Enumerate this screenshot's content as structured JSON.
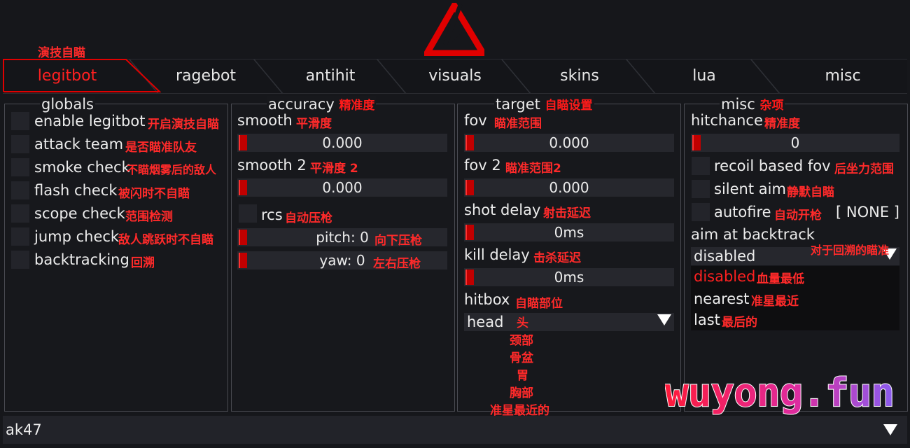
{
  "colors": {
    "accent": "#ff1a1a",
    "background": "#16171b",
    "panel": "#17181c",
    "control": "#26272d"
  },
  "header": {
    "logo_icon": "red-triangle-logo-icon",
    "annotation": "演技自瞄"
  },
  "tabs": [
    "legitbot",
    "ragebot",
    "antihit",
    "visuals",
    "skins",
    "lua",
    "misc"
  ],
  "globals": {
    "title": "globals",
    "items": [
      {
        "label": "enable legitbot",
        "note": "开启演技自瞄"
      },
      {
        "label": "attack team",
        "note": "是否瞄准队友"
      },
      {
        "label": "smoke check",
        "note": "不瞄烟雾后的敌人"
      },
      {
        "label": "flash check",
        "note": "被闪时不自瞄"
      },
      {
        "label": "scope check",
        "note": "范围检测"
      },
      {
        "label": "jump check",
        "note": "敌人跳跃时不自瞄"
      },
      {
        "label": "backtracking",
        "note": "回溯"
      }
    ]
  },
  "accuracy": {
    "title": "accuracy",
    "title_note": "精准度",
    "smooth_label": "smooth",
    "smooth_note": "平滑度",
    "smooth_value": "0.000",
    "smooth2_label": "smooth 2",
    "smooth2_note": "平滑度 2",
    "smooth2_value": "0.000",
    "rcs_label": "rcs",
    "rcs_note": "自动压枪",
    "pitch_value": "pitch: 0",
    "pitch_note": "向下压枪",
    "yaw_value": "yaw: 0",
    "yaw_note": "左右压枪"
  },
  "target": {
    "title": "target",
    "title_note": "自瞄设置",
    "fov_label": "fov",
    "fov_note": "瞄准范围",
    "fov_value": "0.000",
    "fov2_label": "fov 2",
    "fov2_note": "瞄准范围2",
    "fov2_value": "0.000",
    "shot_delay_label": "shot delay",
    "shot_delay_note": "射击延迟",
    "shot_delay_value": "0ms",
    "kill_delay_label": "kill delay",
    "kill_delay_note": "击杀延迟",
    "kill_delay_value": "0ms",
    "hitbox_label": "hitbox",
    "hitbox_note": "自瞄部位",
    "hitbox_selected": "head",
    "hitbox_notes": [
      "头",
      "颈部",
      "骨盆",
      "胃",
      "胸部",
      "准星最近的"
    ]
  },
  "misc": {
    "title": "misc",
    "title_note": "杂项",
    "hitchance_label": "hitchance",
    "hitchance_note": "精准度",
    "hitchance_value": "0",
    "recoil_label": "recoil based fov",
    "recoil_note": "后坐力范围",
    "silent_label": "silent aim",
    "silent_note": "静默自瞄",
    "autofire_label": "autofire",
    "autofire_note": "自动开枪",
    "autofire_key": "[ NONE ]",
    "backtrack_label": "aim at backtrack",
    "backtrack_note": "对于回溯的瞄准",
    "backtrack_selected": "disabled",
    "options": [
      {
        "label": "disabled",
        "note": "血量最低"
      },
      {
        "label": "nearest",
        "note": "准星最近"
      },
      {
        "label": "last",
        "note": "最后的"
      }
    ]
  },
  "bottom": {
    "weapon": "ak47"
  },
  "watermark": {
    "text": "wuyong.fun"
  }
}
